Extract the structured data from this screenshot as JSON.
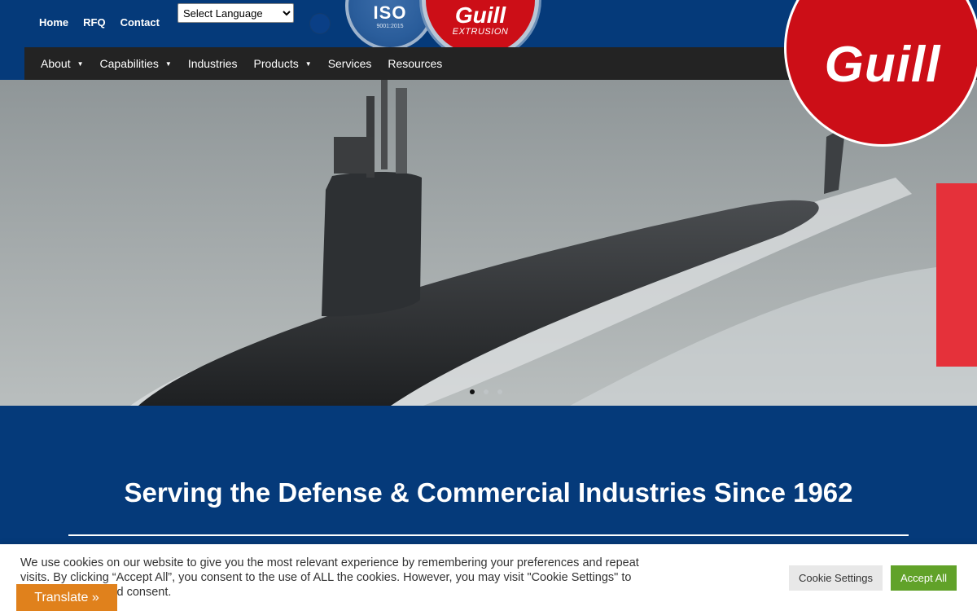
{
  "topbar": {
    "links": [
      "Home",
      "RFQ",
      "Contact"
    ],
    "language_select": "Select Language"
  },
  "badges": {
    "iso_label": "ISO",
    "iso_sub": "9001:2015",
    "extrusion_name": "Guill",
    "extrusion_sub": "EXTRUSION"
  },
  "nav": {
    "items": [
      {
        "label": "About",
        "dropdown": true
      },
      {
        "label": "Capabilities",
        "dropdown": true
      },
      {
        "label": "Industries",
        "dropdown": false
      },
      {
        "label": "Products",
        "dropdown": true
      },
      {
        "label": "Services",
        "dropdown": false
      },
      {
        "label": "Resources",
        "dropdown": false
      }
    ]
  },
  "logo": {
    "text": "Guill"
  },
  "hero": {
    "slide_count": 3,
    "active_slide": 1
  },
  "section": {
    "headline": "Serving the Defense & Commercial Industries Since 1962"
  },
  "cookie": {
    "text": "We use cookies on our website to give you the most relevant experience by remembering your preferences and repeat visits. By clicking “Accept All”, you consent to the use of ALL the cookies. However, you may visit \"Cookie Settings\" to provide a controlled consent.",
    "settings_label": "Cookie Settings",
    "accept_label": "Accept All"
  },
  "translate": {
    "label": "Translate »"
  },
  "colors": {
    "brand_blue": "#053a7a",
    "brand_red": "#cc0e17",
    "accept_green": "#61a229",
    "translate_orange": "#e0811c"
  }
}
